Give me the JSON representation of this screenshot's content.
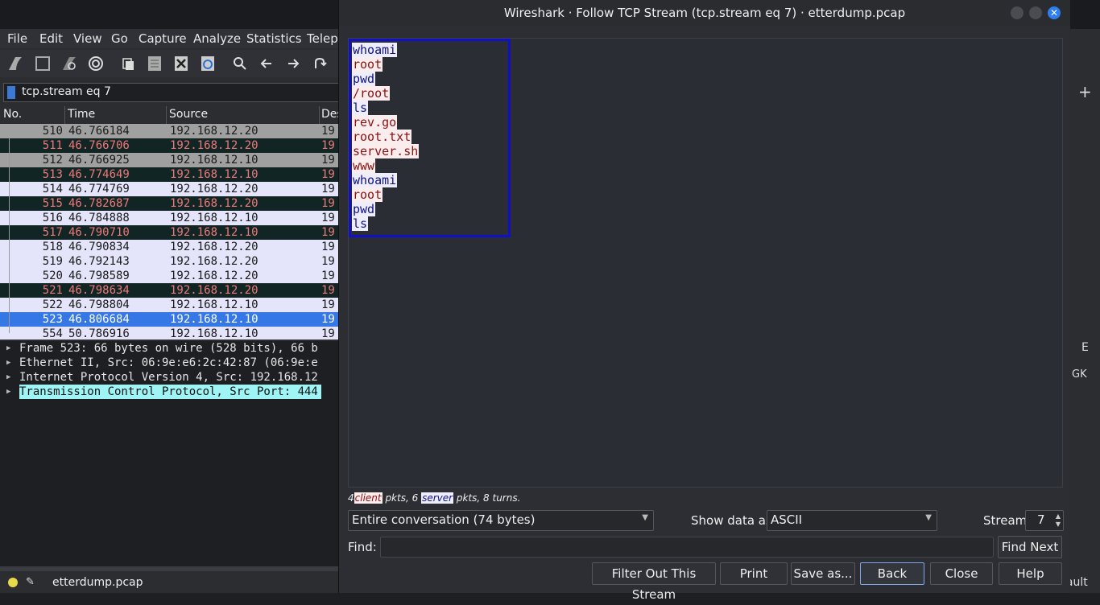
{
  "main_window": {
    "menu": [
      "File",
      "Edit",
      "View",
      "Go",
      "Capture",
      "Analyze",
      "Statistics",
      "Teleph"
    ],
    "display_filter": "tcp.stream eq 7",
    "columns": [
      "No.",
      "Time",
      "Source",
      "Des"
    ],
    "packets": [
      {
        "no": "510",
        "time": "46.766184",
        "src": "192.168.12.20",
        "dst": "19",
        "style": "grey"
      },
      {
        "no": "511",
        "time": "46.766706",
        "src": "192.168.12.20",
        "dst": "19",
        "style": "dark"
      },
      {
        "no": "512",
        "time": "46.766925",
        "src": "192.168.12.10",
        "dst": "19",
        "style": "grey"
      },
      {
        "no": "513",
        "time": "46.774649",
        "src": "192.168.12.10",
        "dst": "19",
        "style": "dark"
      },
      {
        "no": "514",
        "time": "46.774769",
        "src": "192.168.12.20",
        "dst": "19",
        "style": "lav"
      },
      {
        "no": "515",
        "time": "46.782687",
        "src": "192.168.12.20",
        "dst": "19",
        "style": "dark"
      },
      {
        "no": "516",
        "time": "46.784888",
        "src": "192.168.12.10",
        "dst": "19",
        "style": "lav"
      },
      {
        "no": "517",
        "time": "46.790710",
        "src": "192.168.12.10",
        "dst": "19",
        "style": "dark"
      },
      {
        "no": "518",
        "time": "46.790834",
        "src": "192.168.12.20",
        "dst": "19",
        "style": "lav"
      },
      {
        "no": "519",
        "time": "46.792143",
        "src": "192.168.12.20",
        "dst": "19",
        "style": "lav"
      },
      {
        "no": "520",
        "time": "46.798589",
        "src": "192.168.12.20",
        "dst": "19",
        "style": "lav"
      },
      {
        "no": "521",
        "time": "46.798634",
        "src": "192.168.12.20",
        "dst": "19",
        "style": "dark"
      },
      {
        "no": "522",
        "time": "46.798804",
        "src": "192.168.12.10",
        "dst": "19",
        "style": "lav"
      },
      {
        "no": "523",
        "time": "46.806684",
        "src": "192.168.12.10",
        "dst": "19",
        "style": "sel"
      },
      {
        "no": "554",
        "time": "50.786916",
        "src": "192.168.12.10",
        "dst": "19",
        "style": "lav"
      }
    ],
    "details": [
      "Frame 523: 66 bytes on wire (528 bits), 66 b",
      "Ethernet II, Src: 06:9e:e6:2c:42:87 (06:9e:e",
      "Internet Protocol Version 4, Src: 192.168.12",
      "Transmission Control Protocol, Src Port: 444"
    ],
    "status_file": "etterdump.pcap",
    "right_strip": {
      "e": "E",
      "gk": "GK",
      "fault": "fault"
    }
  },
  "dialog": {
    "title": "Wireshark · Follow TCP Stream (tcp.stream eq 7) · etterdump.pcap",
    "stream_lines": [
      {
        "text": "whoami",
        "dir": "server"
      },
      {
        "text": "root",
        "dir": "client"
      },
      {
        "text": "pwd",
        "dir": "server"
      },
      {
        "text": "/root",
        "dir": "client"
      },
      {
        "text": "ls",
        "dir": "server"
      },
      {
        "text": "rev.go",
        "dir": "client"
      },
      {
        "text": "root.txt",
        "dir": "client"
      },
      {
        "text": "server.sh",
        "dir": "client"
      },
      {
        "text": "www",
        "dir": "client"
      },
      {
        "text": "whoami",
        "dir": "server"
      },
      {
        "text": "root",
        "dir": "client"
      },
      {
        "text": "pwd",
        "dir": "server"
      },
      {
        "text": "ls",
        "dir": "server"
      }
    ],
    "summary": {
      "client_count": "4",
      "client_label": "client",
      "pkts1": "pkts, 6",
      "server_label": "server",
      "tail": "pkts, 8 turns."
    },
    "conversation_select": "Entire conversation (74 bytes)",
    "show_data_label": "Show data as",
    "show_data_value": "ASCII",
    "stream_label": "Stream",
    "stream_value": "7",
    "find_label": "Find:",
    "find_value": "",
    "find_next": "Find Next",
    "buttons": {
      "filter_out": "Filter Out This Stream",
      "print": "Print",
      "save_as": "Save as...",
      "back": "Back",
      "close": "Close",
      "help": "Help"
    },
    "colors": {
      "client_bg": "#fbeded",
      "client_fg": "#8a1010",
      "server_bg": "#ededfb",
      "server_fg": "#10108a",
      "highlight_box": "#1010c8"
    }
  }
}
